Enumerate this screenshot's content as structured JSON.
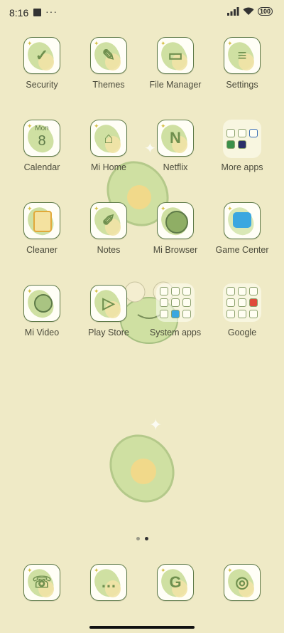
{
  "status": {
    "time": "8:16",
    "battery": "100"
  },
  "apps": [
    {
      "label": "Security",
      "glyph": "✓"
    },
    {
      "label": "Themes",
      "glyph": "✎"
    },
    {
      "label": "File Manager",
      "glyph": "▭"
    },
    {
      "label": "Settings",
      "glyph": "≡"
    },
    {
      "label": "Calendar",
      "glyph": "8",
      "sub": "Mon"
    },
    {
      "label": "Mi Home",
      "glyph": "⌂"
    },
    {
      "label": "Netflix",
      "glyph": "N"
    },
    {
      "label": "Cleaner",
      "glyph": "▯"
    },
    {
      "label": "Notes",
      "glyph": "✐"
    },
    {
      "label": "Mi Browser",
      "glyph": "◐"
    },
    {
      "label": "Game Center",
      "glyph": "🎮"
    },
    {
      "label": "Mi Video",
      "glyph": "◉"
    },
    {
      "label": "Play Store",
      "glyph": "▷"
    }
  ],
  "folders": [
    {
      "label": "More apps"
    },
    {
      "label": "System apps"
    },
    {
      "label": "Google"
    }
  ],
  "dock": [
    {
      "name": "phone",
      "glyph": "☏"
    },
    {
      "name": "messages",
      "glyph": "…"
    },
    {
      "name": "google",
      "glyph": "G"
    },
    {
      "name": "camera",
      "glyph": "◎"
    }
  ],
  "pages": {
    "current": 2,
    "total": 2
  },
  "colors": {
    "background": "#efeac6",
    "icon_border": "#5e7a48",
    "avocado": "#cfe0a2",
    "pit": "#f1d98a"
  }
}
